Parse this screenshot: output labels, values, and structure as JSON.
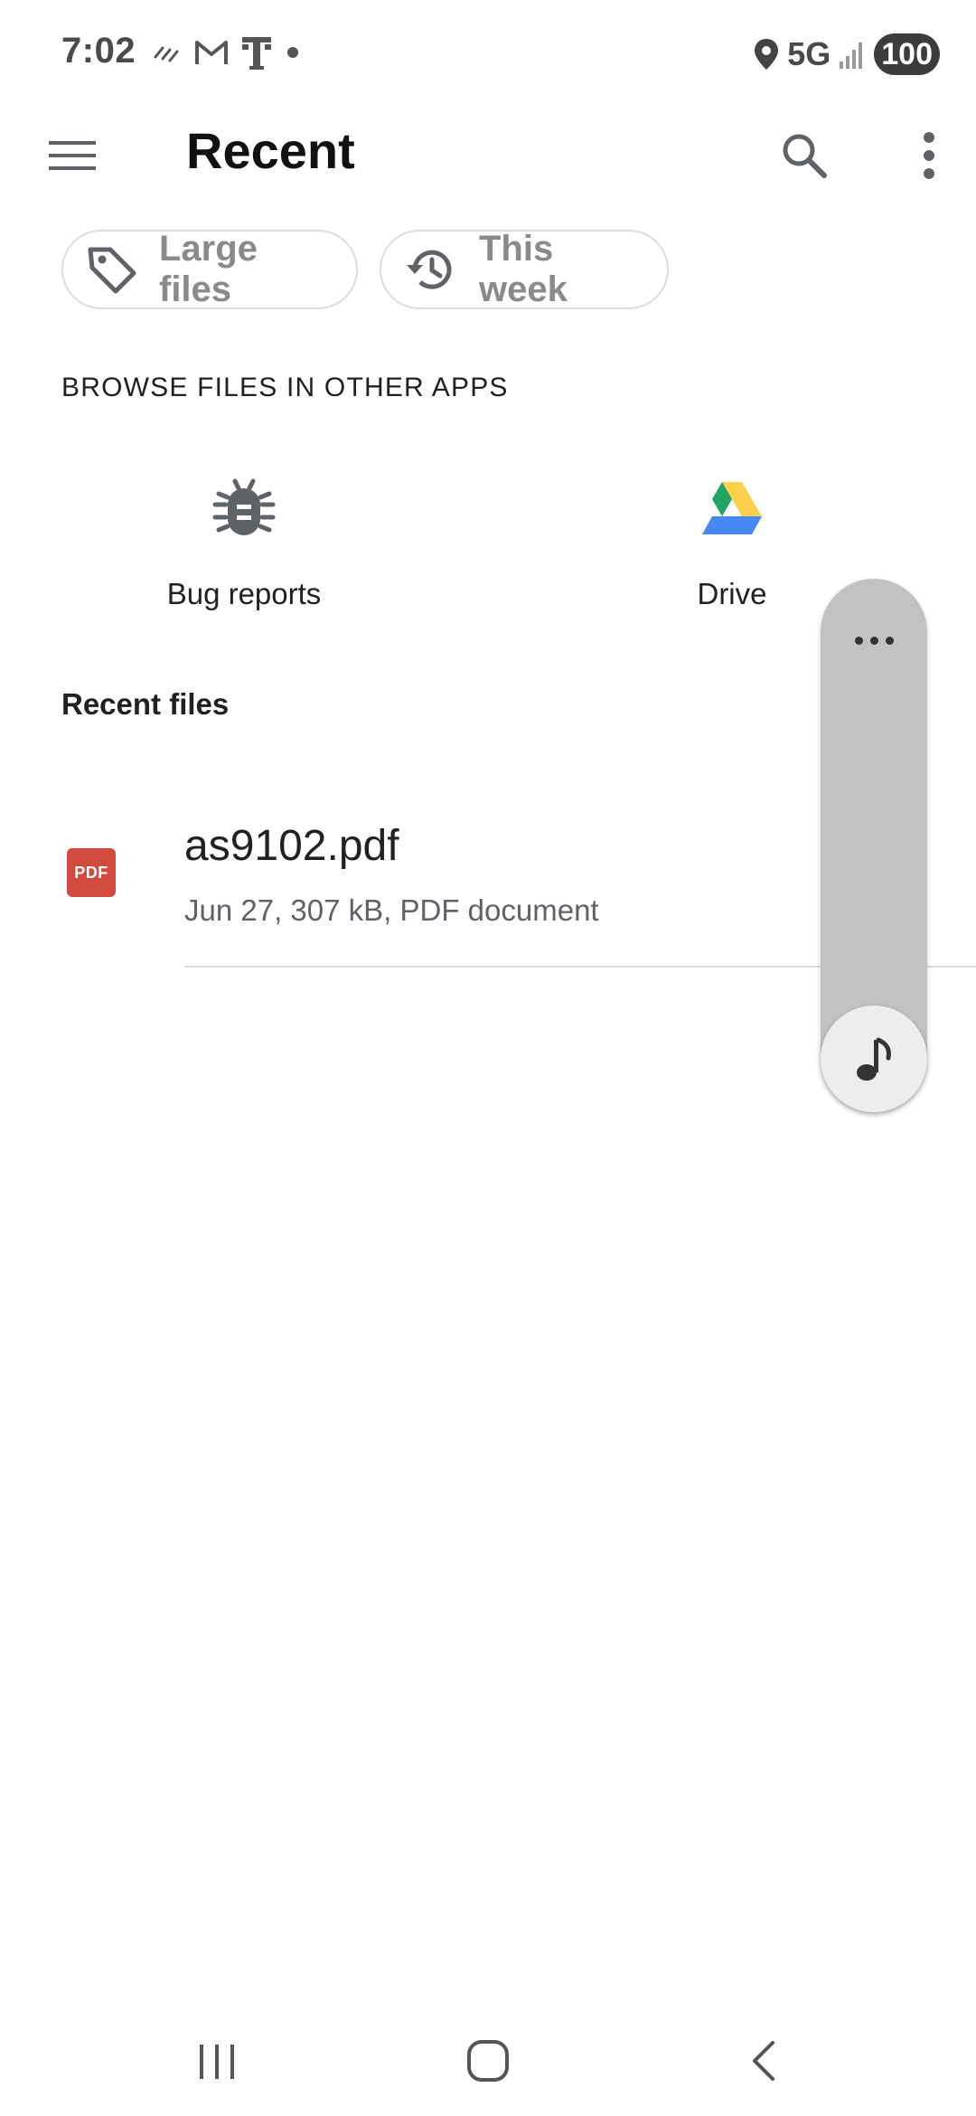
{
  "status_bar": {
    "time": "7:02",
    "network": "5G",
    "battery": "100",
    "left_icons": [
      "wifi-calling-icon",
      "gmail-icon",
      "t-mobile-icon",
      "notification-dot-icon"
    ],
    "right_icons": [
      "location-icon",
      "signal-bars-icon"
    ]
  },
  "app_bar": {
    "title": "Recent",
    "menu_icon": "hamburger-menu-icon",
    "search_icon": "search-icon",
    "overflow_icon": "more-vert-icon"
  },
  "chips": [
    {
      "label": "Large files",
      "icon": "tag-icon"
    },
    {
      "label": "This week",
      "icon": "history-icon"
    }
  ],
  "browse_section": {
    "header": "BROWSE FILES IN OTHER APPS",
    "apps": [
      {
        "label": "Bug reports",
        "icon": "bug-icon"
      },
      {
        "label": "Drive",
        "icon": "google-drive-icon",
        "colors": [
          "#1fa463",
          "#ffd04b",
          "#4688f4"
        ]
      }
    ]
  },
  "recent_files": {
    "header": "Recent files",
    "items": [
      {
        "name": "as9102.pdf",
        "meta": "Jun 27, 307 kB, PDF document",
        "icon_label": "PDF",
        "icon_color": "#d24a3e"
      }
    ]
  },
  "floating_panel": {
    "top_icon": "more-horiz-icon",
    "bottom_icon": "music-note-icon"
  },
  "nav_bar": {
    "buttons": [
      "recents-icon",
      "home-icon",
      "back-icon"
    ]
  },
  "colors": {
    "chip_border": "#dadce0",
    "chip_text": "#8a8a8a",
    "meta_text": "#5f6368",
    "panel_bg": "#c2c2c2"
  }
}
